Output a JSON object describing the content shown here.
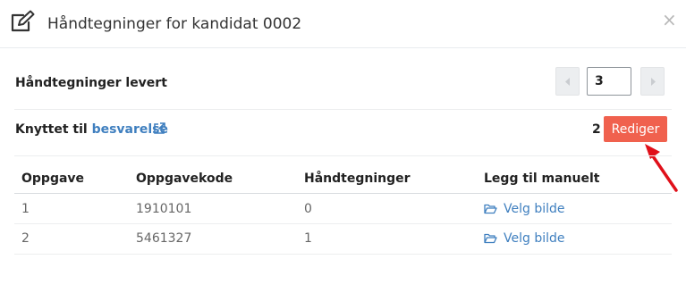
{
  "modal": {
    "title": "Håndtegninger for kandidat 0002",
    "close_label": "×"
  },
  "delivered": {
    "label": "Håndtegninger levert",
    "value": "3"
  },
  "linked": {
    "prefix": "Knyttet til",
    "link_text": "besvarelse",
    "count": "2",
    "edit_label": "Rediger"
  },
  "table": {
    "headers": [
      "Oppgave",
      "Oppgavekode",
      "Håndtegninger",
      "Legg til manuelt"
    ],
    "rows": [
      {
        "oppgave": "1",
        "kode": "1910101",
        "antall": "0",
        "action": "Velg bilde"
      },
      {
        "oppgave": "2",
        "kode": "5461327",
        "antall": "1",
        "action": "Velg bilde"
      }
    ]
  },
  "colors": {
    "accent_link": "#3f7fbf",
    "button_red": "#f0614e",
    "annotation_arrow": "#e0101a"
  },
  "icons": [
    "edit-icon",
    "close-icon",
    "caret-left-icon",
    "caret-right-icon",
    "external-link-icon",
    "folder-open-icon"
  ]
}
